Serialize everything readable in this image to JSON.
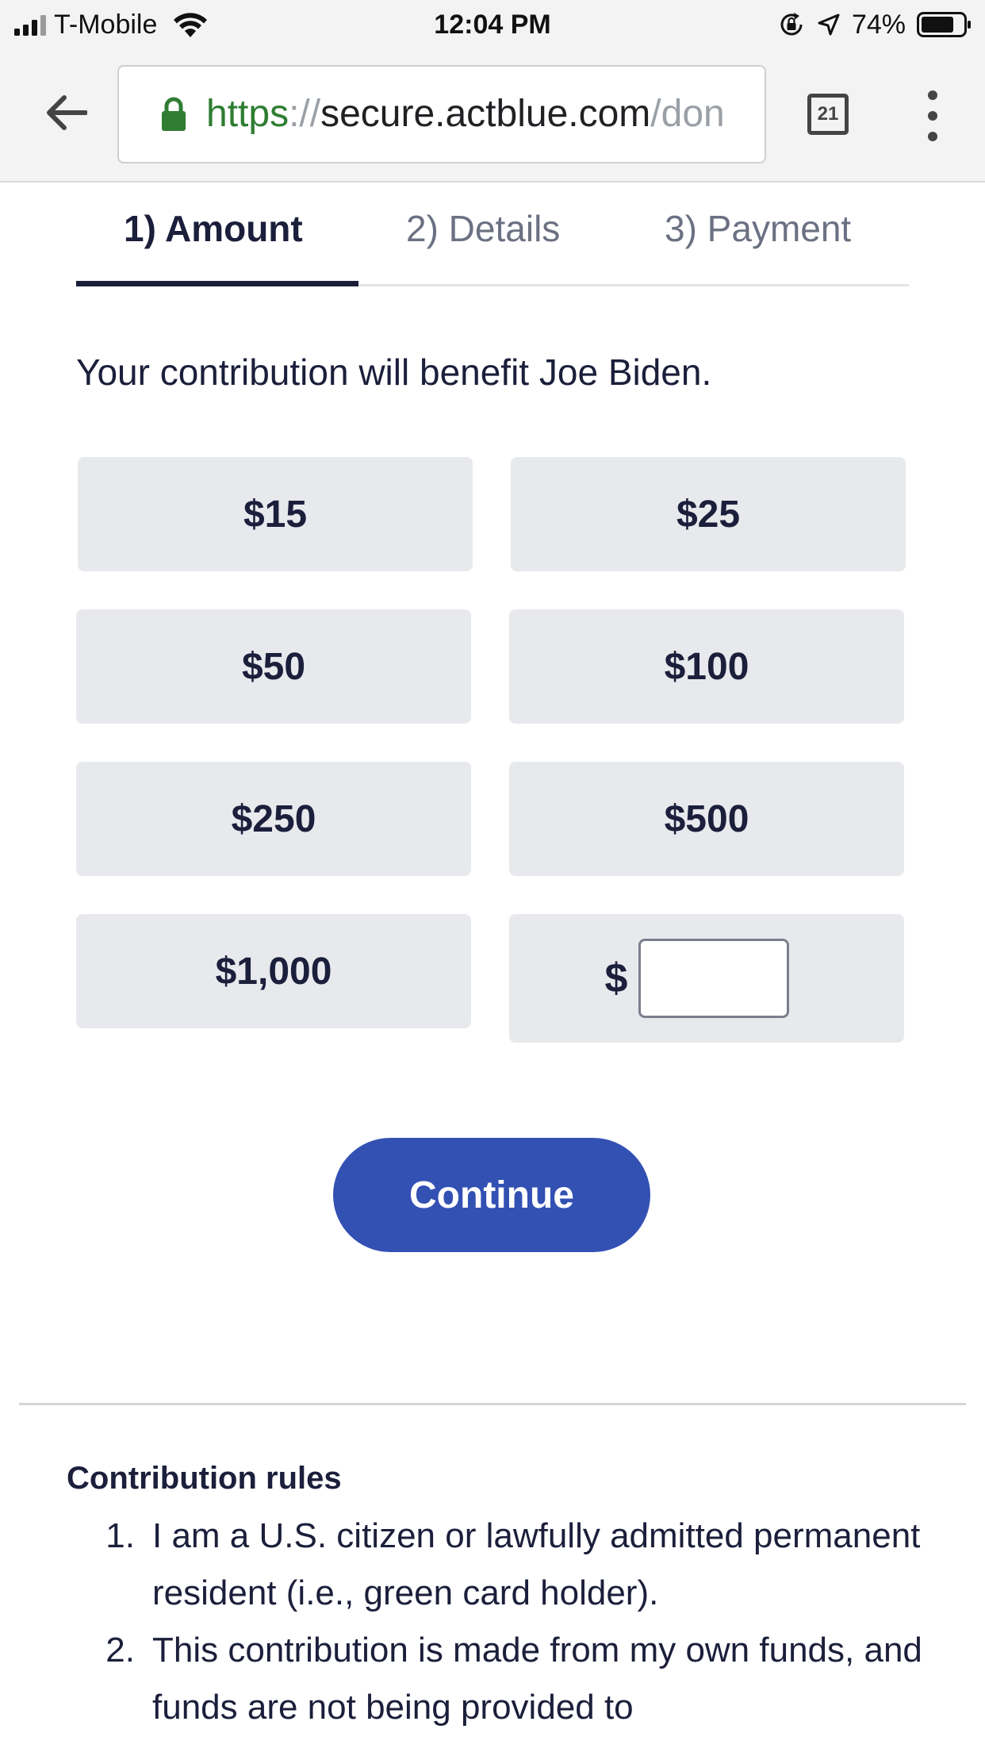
{
  "status_bar": {
    "carrier": "T-Mobile",
    "time": "12:04 PM",
    "battery_percent": "74%",
    "icons": [
      "signal-icon",
      "wifi-icon",
      "rotation-lock-icon",
      "location-icon",
      "battery-icon"
    ]
  },
  "browser": {
    "url_scheme": "https",
    "url_separator": "://",
    "url_host": "secure.actblue.com",
    "url_path": "/don",
    "tab_count": "21",
    "secure_color": "#2e7d32"
  },
  "steps": [
    {
      "label": "1) Amount",
      "active": true
    },
    {
      "label": "2) Details",
      "active": false
    },
    {
      "label": "3) Payment",
      "active": false
    }
  ],
  "benefit_text": "Your contribution will benefit Joe Biden.",
  "amounts": [
    "$15",
    "$25",
    "$50",
    "$100",
    "$250",
    "$500",
    "$1,000"
  ],
  "custom_amount": {
    "currency_symbol": "$",
    "value": ""
  },
  "continue_label": "Continue",
  "rules": {
    "title": "Contribution rules",
    "items": [
      {
        "num": "1.",
        "text": "I am a U.S. citizen or lawfully admitted permanent resident (i.e., green card holder)."
      },
      {
        "num": "2.",
        "text": "This contribution is made from my own funds, and funds are not being provided to"
      }
    ]
  },
  "colors": {
    "accent": "#3350b3",
    "text": "#1b1f3b",
    "button_bg": "#e8e9ed"
  }
}
